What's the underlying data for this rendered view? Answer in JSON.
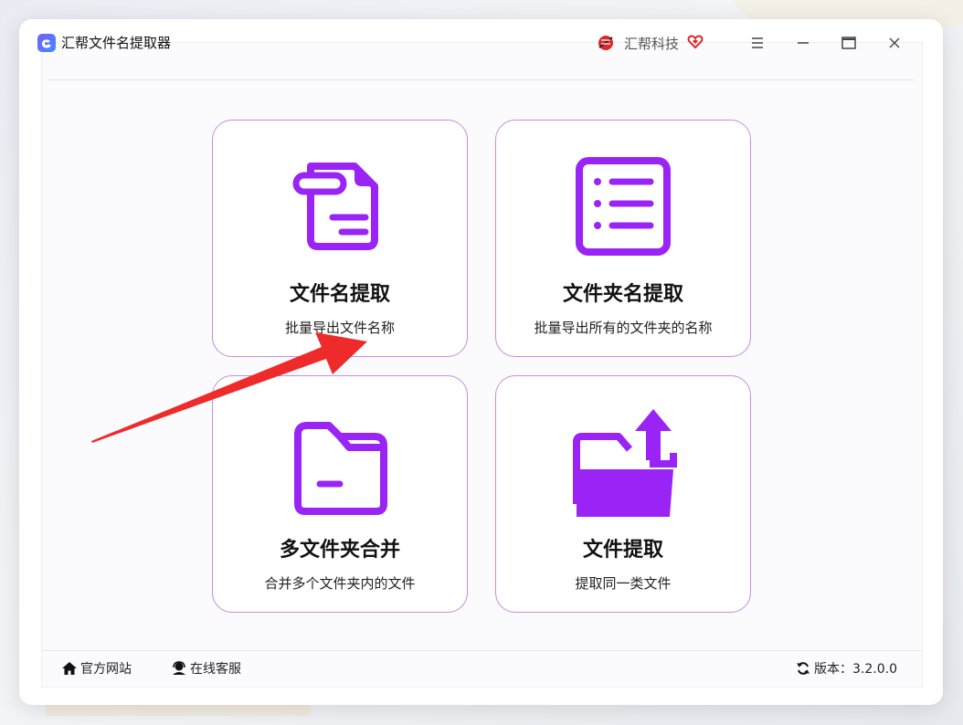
{
  "app": {
    "title": "汇帮文件名提取器",
    "brand_name": "汇帮科技"
  },
  "window_controls": {
    "menu_icon": "menu-icon",
    "minimize_icon": "minimize-icon",
    "maximize_icon": "maximize-icon",
    "close_icon": "close-icon"
  },
  "cards": [
    {
      "title": "文件名提取",
      "subtitle": "批量导出文件名称",
      "icon": "file-document-icon"
    },
    {
      "title": "文件夹名提取",
      "subtitle": "批量导出所有的文件夹的名称",
      "icon": "list-icon"
    },
    {
      "title": "多文件夹合并",
      "subtitle": "合并多个文件夹内的文件",
      "icon": "folder-icon"
    },
    {
      "title": "文件提取",
      "subtitle": "提取同一类文件",
      "icon": "folder-export-icon"
    }
  ],
  "footer": {
    "website_label": "官方网站",
    "support_label": "在线客服",
    "version_label": "版本：3.2.0.0"
  },
  "colors": {
    "accent": "#9a24f5",
    "card_border": "#c98be0",
    "annotation_arrow": "#ee2a2a"
  }
}
